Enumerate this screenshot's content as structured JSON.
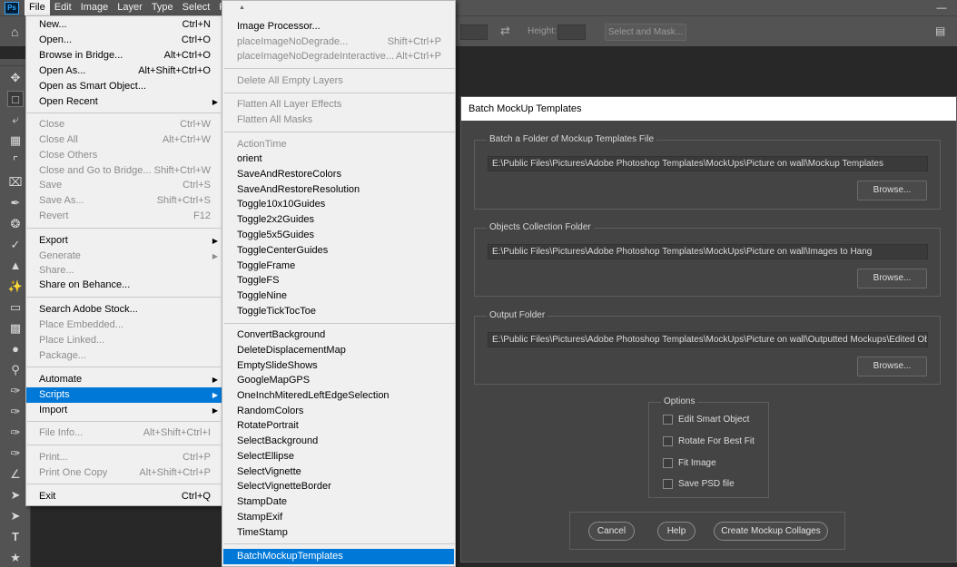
{
  "menubar": {
    "logo": "Ps",
    "items": [
      "File",
      "Edit",
      "Image",
      "Layer",
      "Type",
      "Select",
      "Filt"
    ]
  },
  "optionsbar": {
    "height_label": "Height:",
    "select_mask_label": "Select and Mask..."
  },
  "file_menu": {
    "items": [
      {
        "label": "New...",
        "shortcut": "Ctrl+N"
      },
      {
        "label": "Open...",
        "shortcut": "Ctrl+O"
      },
      {
        "label": "Browse in Bridge...",
        "shortcut": "Alt+Ctrl+O"
      },
      {
        "label": "Open As...",
        "shortcut": "Alt+Shift+Ctrl+O"
      },
      {
        "label": "Open as Smart Object...",
        "shortcut": ""
      },
      {
        "label": "Open Recent",
        "shortcut": ""
      },
      {
        "label": "Close",
        "shortcut": "Ctrl+W"
      },
      {
        "label": "Close All",
        "shortcut": "Alt+Ctrl+W"
      },
      {
        "label": "Close Others",
        "shortcut": ""
      },
      {
        "label": "Close and Go to Bridge...",
        "shortcut": "Shift+Ctrl+W"
      },
      {
        "label": "Save",
        "shortcut": "Ctrl+S"
      },
      {
        "label": "Save As...",
        "shortcut": "Shift+Ctrl+S"
      },
      {
        "label": "Revert",
        "shortcut": "F12"
      },
      {
        "label": "Export",
        "shortcut": ""
      },
      {
        "label": "Generate",
        "shortcut": ""
      },
      {
        "label": "Share...",
        "shortcut": ""
      },
      {
        "label": "Share on Behance...",
        "shortcut": ""
      },
      {
        "label": "Search Adobe Stock...",
        "shortcut": ""
      },
      {
        "label": "Place Embedded...",
        "shortcut": ""
      },
      {
        "label": "Place Linked...",
        "shortcut": ""
      },
      {
        "label": "Package...",
        "shortcut": ""
      },
      {
        "label": "Automate",
        "shortcut": ""
      },
      {
        "label": "Scripts",
        "shortcut": ""
      },
      {
        "label": "Import",
        "shortcut": ""
      },
      {
        "label": "File Info...",
        "shortcut": "Alt+Shift+Ctrl+I"
      },
      {
        "label": "Print...",
        "shortcut": "Ctrl+P"
      },
      {
        "label": "Print One Copy",
        "shortcut": "Alt+Shift+Ctrl+P"
      },
      {
        "label": "Exit",
        "shortcut": "Ctrl+Q"
      }
    ]
  },
  "scripts_menu": {
    "items": [
      {
        "label": "Image Processor...",
        "shortcut": ""
      },
      {
        "label": "placeImageNoDegrade...",
        "shortcut": "Shift+Ctrl+P"
      },
      {
        "label": "placeImageNoDegradeInteractive...",
        "shortcut": "Alt+Ctrl+P"
      },
      {
        "label": "Delete All Empty Layers",
        "shortcut": ""
      },
      {
        "label": "Flatten All Layer Effects",
        "shortcut": ""
      },
      {
        "label": "Flatten All Masks",
        "shortcut": ""
      },
      {
        "label": "ActionTime",
        "shortcut": ""
      },
      {
        "label": "orient",
        "shortcut": ""
      },
      {
        "label": "SaveAndRestoreColors",
        "shortcut": ""
      },
      {
        "label": "SaveAndRestoreResolution",
        "shortcut": ""
      },
      {
        "label": "Toggle10x10Guides",
        "shortcut": ""
      },
      {
        "label": "Toggle2x2Guides",
        "shortcut": ""
      },
      {
        "label": "Toggle5x5Guides",
        "shortcut": ""
      },
      {
        "label": "ToggleCenterGuides",
        "shortcut": ""
      },
      {
        "label": "ToggleFrame",
        "shortcut": ""
      },
      {
        "label": "ToggleFS",
        "shortcut": ""
      },
      {
        "label": "ToggleNine",
        "shortcut": ""
      },
      {
        "label": "ToggleTickTocToe",
        "shortcut": ""
      },
      {
        "label": "ConvertBackground",
        "shortcut": ""
      },
      {
        "label": "DeleteDisplacementMap",
        "shortcut": ""
      },
      {
        "label": "EmptySlideShows",
        "shortcut": ""
      },
      {
        "label": "GoogleMapGPS",
        "shortcut": ""
      },
      {
        "label": "OneInchMiteredLeftEdgeSelection",
        "shortcut": ""
      },
      {
        "label": "RandomColors",
        "shortcut": ""
      },
      {
        "label": "RotatePortrait",
        "shortcut": ""
      },
      {
        "label": "SelectBackground",
        "shortcut": ""
      },
      {
        "label": "SelectEllipse",
        "shortcut": ""
      },
      {
        "label": "SelectVignette",
        "shortcut": ""
      },
      {
        "label": "SelectVignetteBorder",
        "shortcut": ""
      },
      {
        "label": "StampDate",
        "shortcut": ""
      },
      {
        "label": "StampExif",
        "shortcut": ""
      },
      {
        "label": "TimeStamp",
        "shortcut": ""
      },
      {
        "label": "BatchMockupTemplates",
        "shortcut": ""
      }
    ]
  },
  "dialog": {
    "title": "Batch MockUp Templates",
    "templates": {
      "label": "Batch a Folder of Mockup Templates File",
      "path": "E:\\Public Files\\Pictures\\Adobe Photoshop Templates\\MockUps\\Picture on wall\\Mockup Templates",
      "browse": "Browse..."
    },
    "objects": {
      "label": "Objects Collection Folder",
      "path": "E:\\Public Files\\Pictures\\Adobe Photoshop Templates\\MockUps\\Picture on wall\\Images to Hang",
      "browse": "Browse..."
    },
    "output": {
      "label": "Output Folder",
      "path": "E:\\Public Files\\Pictures\\Adobe Photoshop Templates\\MockUps\\Picture on wall\\Outputted Mockups\\Edited Objects",
      "browse": "Browse..."
    },
    "options": {
      "label": "Options",
      "edit_smart_object": "Edit Smart Object",
      "rotate_best_fit": "Rotate For Best Fit",
      "fit_image": "Fit Image",
      "save_psd": "Save PSD file"
    },
    "buttons": {
      "cancel": "Cancel",
      "help": "Help",
      "create": "Create Mockup Collages"
    }
  },
  "colors": {
    "highlight": "#0078d7",
    "menu_bg": "#f0f0f0",
    "dialog_bg": "#444444",
    "app_bg": "#535353"
  }
}
